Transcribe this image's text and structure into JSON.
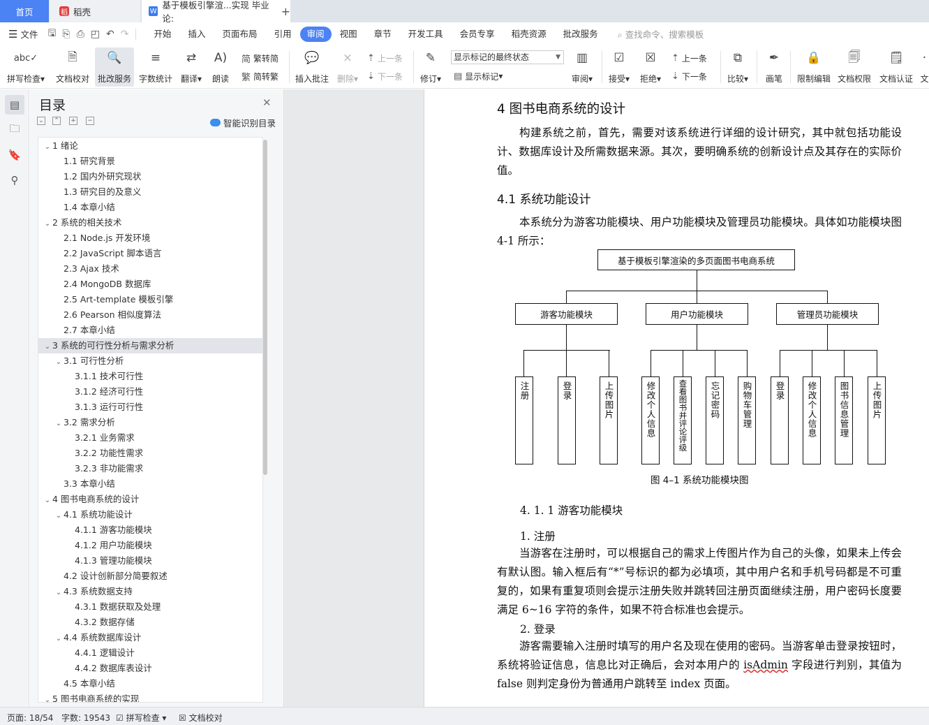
{
  "tabs": {
    "home": "首页",
    "daoke": "稻壳",
    "doc": "基于模板引擎渲...实现 毕业论:",
    "new_tab": "+"
  },
  "menubar": {
    "file": "文件",
    "tabs": [
      "开始",
      "插入",
      "页面布局",
      "引用",
      "审阅",
      "视图",
      "章节",
      "开发工具",
      "会员专享",
      "稻壳资源",
      "批改服务"
    ],
    "active_tab": "审阅",
    "search_placeholder": "查找命令、搜索模板"
  },
  "ribbon": {
    "spellcheck": "拼写检查",
    "doc_proof": "文档校对",
    "review_service": "批改服务",
    "word_count": "字数统计",
    "translate": "翻译",
    "read_aloud": "朗读",
    "trad_convert": "繁转简",
    "simp_convert": "简转繁",
    "insert_comment": "插入批注",
    "delete": "删除",
    "prev": "上一条",
    "next": "下一条",
    "revise": "修订",
    "display_select": "显示标记的最终状态",
    "show_markup": "显示标记",
    "review": "审阅",
    "accept": "接受",
    "reject": "拒绝",
    "prev2": "上一条",
    "next2": "下一条",
    "compare": "比较",
    "pen": "画笔",
    "restrict_edit": "限制编辑",
    "doc_permission": "文档权限",
    "doc_cert": "文档认证",
    "more": "文"
  },
  "toc": {
    "title": "目录",
    "smart": "智能识别目录",
    "items": [
      {
        "label": "1  绪论",
        "level": 1,
        "caret": true
      },
      {
        "label": "1.1  研究背景",
        "level": 2
      },
      {
        "label": "1.2  国内外研究现状",
        "level": 2
      },
      {
        "label": "1.3  研究目的及意义",
        "level": 2
      },
      {
        "label": "1.4  本章小结",
        "level": 2
      },
      {
        "label": "2  系统的相关技术",
        "level": 1,
        "caret": true
      },
      {
        "label": "2.1 Node.js 开发环境",
        "level": 2
      },
      {
        "label": "2.2 JavaScript 脚本语言",
        "level": 2
      },
      {
        "label": "2.3 Ajax 技术",
        "level": 2
      },
      {
        "label": "2.4 MongoDB 数据库",
        "level": 2
      },
      {
        "label": "2.5 Art-template 模板引擎",
        "level": 2
      },
      {
        "label": "2.6 Pearson 相似度算法",
        "level": 2
      },
      {
        "label": "2.7  本章小结",
        "level": 2
      },
      {
        "label": "3  系统的可行性分析与需求分析",
        "level": 1,
        "caret": true,
        "selected": true
      },
      {
        "label": "3.1  可行性分析",
        "level": 2,
        "caret": true
      },
      {
        "label": "3.1.1  技术可行性",
        "level": 3
      },
      {
        "label": "3.1.2  经济可行性",
        "level": 3
      },
      {
        "label": "3.1.3  运行可行性",
        "level": 3
      },
      {
        "label": "3.2  需求分析",
        "level": 2,
        "caret": true
      },
      {
        "label": "3.2.1  业务需求",
        "level": 3
      },
      {
        "label": "3.2.2  功能性需求",
        "level": 3
      },
      {
        "label": "3.2.3  非功能需求",
        "level": 3
      },
      {
        "label": "3.3  本章小结",
        "level": 2
      },
      {
        "label": "4  图书电商系统的设计",
        "level": 1,
        "caret": true
      },
      {
        "label": "4.1  系统功能设计",
        "level": 2,
        "caret": true
      },
      {
        "label": "4.1.1  游客功能模块",
        "level": 3
      },
      {
        "label": "4.1.2  用户功能模块",
        "level": 3
      },
      {
        "label": "4.1.3  管理功能模块",
        "level": 3
      },
      {
        "label": "4.2  设计创新部分简要叙述",
        "level": 2
      },
      {
        "label": "4.3  系统数据支持",
        "level": 2,
        "caret": true
      },
      {
        "label": "4.3.1  数据获取及处理",
        "level": 3
      },
      {
        "label": "4.3.2  数据存储",
        "level": 3
      },
      {
        "label": "4.4  系统数据库设计",
        "level": 2,
        "caret": true
      },
      {
        "label": "4.4.1  逻辑设计",
        "level": 3
      },
      {
        "label": "4.4.2  数据库表设计",
        "level": 3
      },
      {
        "label": "4.5  本章小结",
        "level": 2
      },
      {
        "label": "5  图书电商系统的实现",
        "level": 1,
        "caret": true
      }
    ]
  },
  "document": {
    "heading1": "4  图书电商系统的设计",
    "intro": "构建系统之前，首先，需要对该系统进行详细的设计研究，其中就包括功能设计、数据库设计及所需数据来源。其次，要明确系统的创新设计点及其存在的实际价值。",
    "heading2": "4.1  系统功能设计",
    "module_intro": "本系统分为游客功能模块、用户功能模块及管理员功能模块。具体如功能模块图 4-1 所示：",
    "diagram": {
      "root": "基于模板引擎渲染的多页面图书电商系统",
      "modules": [
        "游客功能模块",
        "用户功能模块",
        "管理员功能模块"
      ],
      "leaves": [
        [
          "注册",
          "登录",
          "上传图片"
        ],
        [
          "修改个人信息",
          "查看图书并评论评级",
          "忘记密码",
          "购物车管理"
        ],
        [
          "登录",
          "修改个人信息",
          "图书信息管理",
          "上传图片"
        ]
      ],
      "caption": "图 4–1  系统功能模块图"
    },
    "heading3": "4. 1. 1  游客功能模块",
    "item1_title": "1.  注册",
    "item1_text": "当游客在注册时，可以根据自己的需求上传图片作为自己的头像，如果未上传会有默认图。输入框后有“*”号标识的都为必填项，其中用户名和手机号码都是不可重复的，如果有重复项则会提示注册失败并跳转回注册页面继续注册，用户密码长度要满足 6~16 字符的条件，如果不符合标准也会提示。",
    "item2_title": "2.  登录",
    "item2_text_a": "游客需要输入注册时填写的用户名及现在使用的密码。当游客单击登录按钮时，系统将验证信息，信息比对正确后，会对本用户的 ",
    "item2_keyword": "isAdmin",
    "item2_text_b": " 字段进行判别，其值为 false 则判定身份为普通用户跳转至 index 页面。"
  },
  "status": {
    "page": "页面: 18/54",
    "words": "字数: 19543",
    "spell": "拼写检查",
    "proof": "文档校对"
  }
}
